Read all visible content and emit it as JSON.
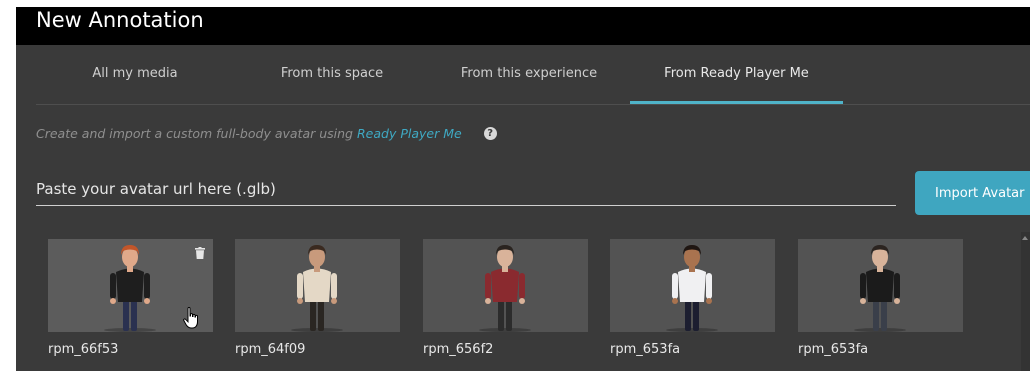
{
  "dialog": {
    "title": "New Annotation"
  },
  "tabs": [
    {
      "label": "All my media"
    },
    {
      "label": "From this space"
    },
    {
      "label": "From this experience"
    },
    {
      "label": "From Ready Player Me",
      "active": true
    }
  ],
  "hint": {
    "text": "Create and import a custom full-body avatar using",
    "link": "Ready Player Me",
    "help_icon": "question-circle-icon"
  },
  "url_input": {
    "placeholder": "Paste your avatar url here (.glb)",
    "value": ""
  },
  "import_button": {
    "label": "Import Avatar"
  },
  "avatars": [
    {
      "label": "rpm_66f53",
      "hair": "#c2562a",
      "skin": "#e0a98a",
      "top": "#1e1e1e",
      "bottom": "#2a3150",
      "delete_icon": "trash-icon"
    },
    {
      "label": "rpm_64f09",
      "hair": "#3a2a20",
      "skin": "#c89a7c",
      "top": "#e4d8c6",
      "bottom": "#2a2622"
    },
    {
      "label": "rpm_656f2",
      "hair": "#2a2420",
      "skin": "#d9b39a",
      "top": "#8a2a2f",
      "bottom": "#2c2c2c"
    },
    {
      "label": "rpm_653fa",
      "hair": "#1f1612",
      "skin": "#a9734f",
      "top": "#f0f0f2",
      "bottom": "#1c1e30"
    },
    {
      "label": "rpm_653fa",
      "hair": "#2b2420",
      "skin": "#d8b39a",
      "top": "#1b1b1b",
      "bottom": "#3a3f4a"
    }
  ],
  "colors": {
    "accent": "#4fb3c9",
    "button": "#3fa6c0",
    "panel": "#3a3a3a",
    "titlebar": "#000000",
    "thumbnail": "#535353"
  }
}
